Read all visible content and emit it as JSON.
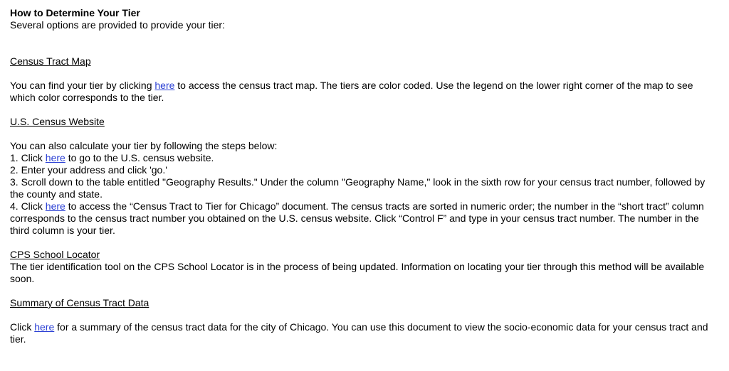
{
  "title": "How to Determine Your Tier",
  "intro": "Several options are provided to provide your tier:",
  "sections": {
    "census_tract_map": {
      "heading": "Census Tract Map",
      "text_before": "You can find your tier by clicking ",
      "link": "here",
      "text_after": " to access the census tract map. The tiers are color coded. Use the legend on the lower right corner of the map to see which color corresponds to the tier."
    },
    "census_website": {
      "heading": "U.S. Census Website",
      "intro": "You can also calculate your tier by following the steps below:",
      "step1_before": "1. Click ",
      "step1_link": "here",
      "step1_after": " to go to the U.S. census website.",
      "step2": "2. Enter your address and click 'go.'",
      "step3": "3. Scroll down to the table entitled \"Geography Results.\" Under the column \"Geography Name,\" look in the sixth row for your census tract number, followed by the county and state.",
      "step4_before": "4. Click ",
      "step4_link": "here",
      "step4_after": " to access the “Census Tract to Tier for Chicago” document. The census tracts are sorted in numeric order; the number in the “short tract” column corresponds to the census tract number you obtained on the U.S. census website. Click “Control F” and type in your census tract number. The number in the third column is your tier."
    },
    "cps_locator": {
      "heading": "CPS School Locator",
      "text": "The tier identification tool on the CPS School Locator is in the process of being updated. Information on locating your tier through this method will be available soon."
    },
    "summary": {
      "heading": "Summary of Census Tract Data",
      "text_before": "Click ",
      "link": "here",
      "text_after": " for a summary of the census tract data for the city of Chicago. You can use this document to view the socio-economic data for your census tract and tier."
    }
  }
}
